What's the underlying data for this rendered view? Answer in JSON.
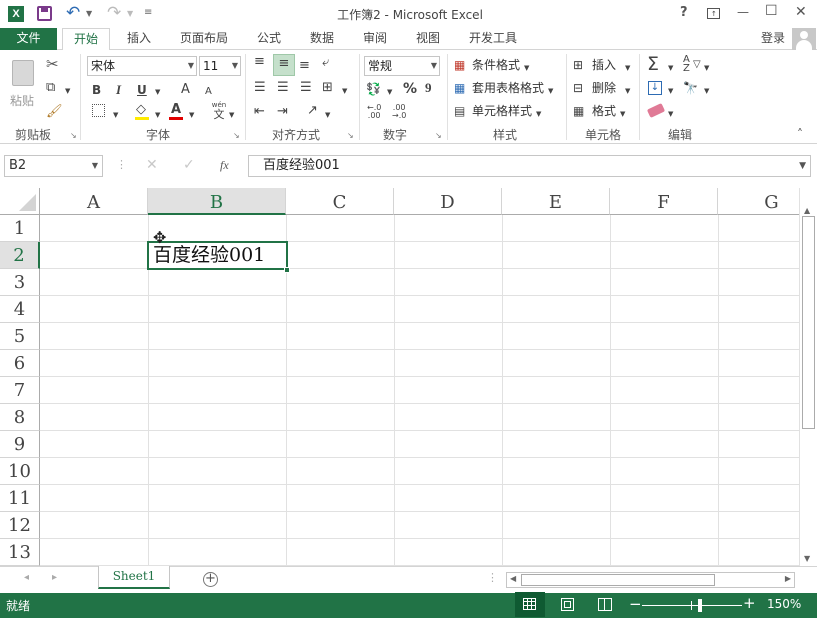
{
  "titlebar": {
    "title": "工作簿2 - Microsoft Excel",
    "help": "?",
    "minimize": "—",
    "maximize": "☐",
    "close": "✕"
  },
  "tabs": {
    "file": "文件",
    "home": "开始",
    "insert": "插入",
    "page_layout": "页面布局",
    "formulas": "公式",
    "data": "数据",
    "review": "审阅",
    "view": "视图",
    "developer": "开发工具",
    "signin": "登录"
  },
  "ribbon": {
    "clipboard": {
      "paste": "粘贴",
      "label": "剪贴板"
    },
    "font": {
      "name": "宋体",
      "size": "11",
      "bold": "B",
      "italic": "I",
      "underline": "U",
      "grow": "A",
      "shrink": "A",
      "label": "字体",
      "wen": "wén",
      "wen_char": "文"
    },
    "alignment": {
      "label": "对齐方式"
    },
    "number": {
      "format": "常规",
      "percent": "%",
      "comma": "9",
      "label": "数字"
    },
    "styles": {
      "conditional": "条件格式",
      "table": "套用表格格式",
      "cell": "单元格样式",
      "label": "样式"
    },
    "cells": {
      "insert": "插入",
      "delete": "删除",
      "format": "格式",
      "label": "单元格"
    },
    "editing": {
      "label": "编辑"
    }
  },
  "formula_bar": {
    "name_box": "B2",
    "fx": "fx",
    "content": "百度经验001"
  },
  "grid": {
    "columns": [
      "A",
      "B",
      "C",
      "D",
      "E",
      "F",
      "G"
    ],
    "rows": [
      "1",
      "2",
      "3",
      "4",
      "5",
      "6",
      "7",
      "8",
      "9",
      "10",
      "11",
      "12",
      "13"
    ],
    "active_cell_value": "百度经验001"
  },
  "sheets": {
    "active": "Sheet1",
    "add": "+"
  },
  "status": {
    "mode": "就绪",
    "zoom": "150%"
  },
  "colors": {
    "accent": "#217346"
  }
}
